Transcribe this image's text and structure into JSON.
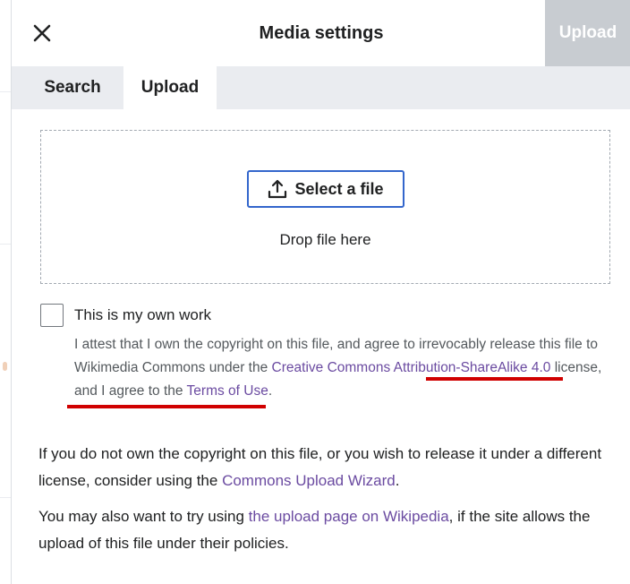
{
  "header": {
    "title": "Media settings",
    "upload_label": "Upload",
    "close_icon": "close-icon"
  },
  "tabs": [
    {
      "label": "Search",
      "active": false
    },
    {
      "label": "Upload",
      "active": true
    }
  ],
  "dropzone": {
    "select_label": "Select a file",
    "select_icon": "upload-icon",
    "drop_text": "Drop file here"
  },
  "own_work": {
    "label": "This is my own work",
    "checked": false
  },
  "attest": {
    "text1": "I attest that I own the copyright on this file, and agree to irrevocably release this file to Wikimedia Commons under the",
    "link1": " Creative Commons Attribution-ShareAlike 4.0",
    "text2": " license, and I agree to the ",
    "link2": "Terms of Use",
    "text3": "."
  },
  "para1": {
    "text1": "If you do not own the copyright on this file, or you wish to release it under a different license, consider using the ",
    "link": "Commons Upload Wizard",
    "text2": "."
  },
  "para2": {
    "text1": "You may also want to try using ",
    "link": "the upload page on Wikipedia",
    "text2": ", if the site allows the upload of this file under their policies."
  },
  "colors": {
    "link": "#6b4ba1",
    "progressive": "#3366cc",
    "disabled_button": "#c8ccd1",
    "annotation_red": "#d00000"
  }
}
